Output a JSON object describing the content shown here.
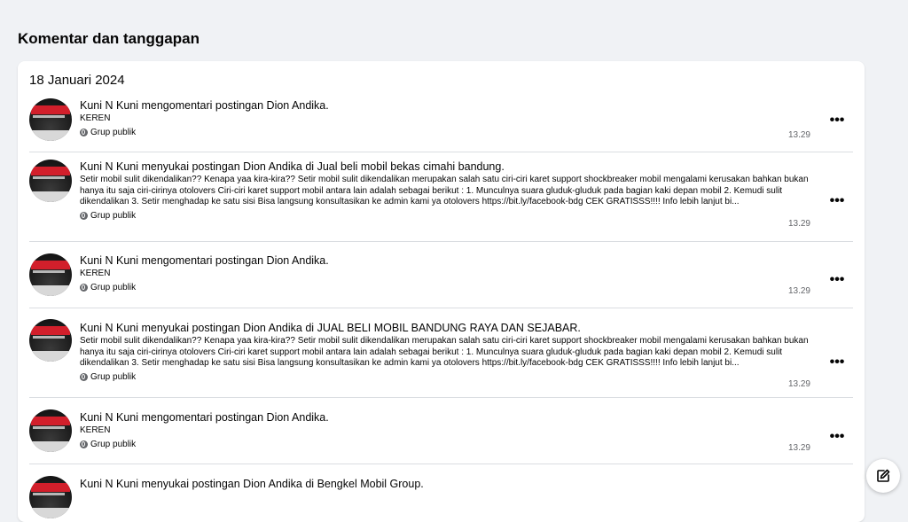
{
  "page": {
    "title": "Komentar dan tanggapan"
  },
  "date_header": "18 Januari 2024",
  "activities": [
    {
      "actor": "Kuni N Kuni",
      "action": " mengomentari postingan ",
      "target": "Dion Andika",
      "connector": "",
      "group": "",
      "end": ".",
      "text": "KEREN",
      "privacy": "Grup publik",
      "time": "13.29"
    },
    {
      "actor": "Kuni N Kuni",
      "action": " menyukai postingan ",
      "target": "Dion Andika",
      "connector": " di ",
      "group": "Jual beli mobil bekas cimahi bandung",
      "end": ".",
      "text": "Setir mobil sulit dikendalikan?? Kenapa yaa kira-kira?? Setir mobil sulit dikendalikan merupakan salah satu ciri-ciri karet support shockbreaker mobil mengalami kerusakan bahkan bukan hanya itu saja ciri-cirinya otolovers Ciri-ciri karet support mobil antara lain adalah sebagai berikut : 1. Munculnya suara gluduk-gluduk pada bagian kaki depan mobil 2. Kemudi sulit dikendalikan 3. Setir menghadap ke satu sisi Bisa langsung konsultasikan ke admin kami ya otolovers https://bit.ly/facebook-bdg CEK GRATISSS!!!! Info lebih lanjut bi...",
      "privacy": "Grup publik",
      "time": "13.29"
    },
    {
      "actor": "Kuni N Kuni",
      "action": " mengomentari postingan ",
      "target": "Dion Andika",
      "connector": "",
      "group": "",
      "end": ".",
      "text": "KEREN",
      "privacy": "Grup publik",
      "time": "13.29"
    },
    {
      "actor": "Kuni N Kuni",
      "action": " menyukai postingan ",
      "target": "Dion Andika",
      "connector": " di ",
      "group": "JUAL BELI MOBIL BANDUNG RAYA DAN SEJABAR",
      "end": ".",
      "text": "Setir mobil sulit dikendalikan?? Kenapa yaa kira-kira?? Setir mobil sulit dikendalikan merupakan salah satu ciri-ciri karet support shockbreaker mobil mengalami kerusakan bahkan bukan hanya itu saja ciri-cirinya otolovers Ciri-ciri karet support mobil antara lain adalah sebagai berikut : 1. Munculnya suara gluduk-gluduk pada bagian kaki depan mobil 2. Kemudi sulit dikendalikan 3. Setir menghadap ke satu sisi Bisa langsung konsultasikan ke admin kami ya otolovers https://bit.ly/facebook-bdg CEK GRATISSS!!!! Info lebih lanjut bi...",
      "privacy": "Grup publik",
      "time": "13.29"
    },
    {
      "actor": "Kuni N Kuni",
      "action": " mengomentari postingan ",
      "target": "Dion Andika",
      "connector": "",
      "group": "",
      "end": ".",
      "text": "KEREN",
      "privacy": "Grup publik",
      "time": "13.29"
    },
    {
      "actor": "Kuni N Kuni",
      "action": " menyukai postingan ",
      "target": "Dion Andika",
      "connector": " di ",
      "group": "Bengkel Mobil Group",
      "end": ".",
      "text": "",
      "privacy": "",
      "time": ""
    }
  ],
  "icons": {
    "privacy": "globe-icon",
    "more": "more-options-icon",
    "edit": "edit-icon"
  },
  "colors": {
    "background": "#f0f2f5",
    "card": "#ffffff",
    "divider": "#dadde1",
    "secondary_text": "#65676b"
  }
}
